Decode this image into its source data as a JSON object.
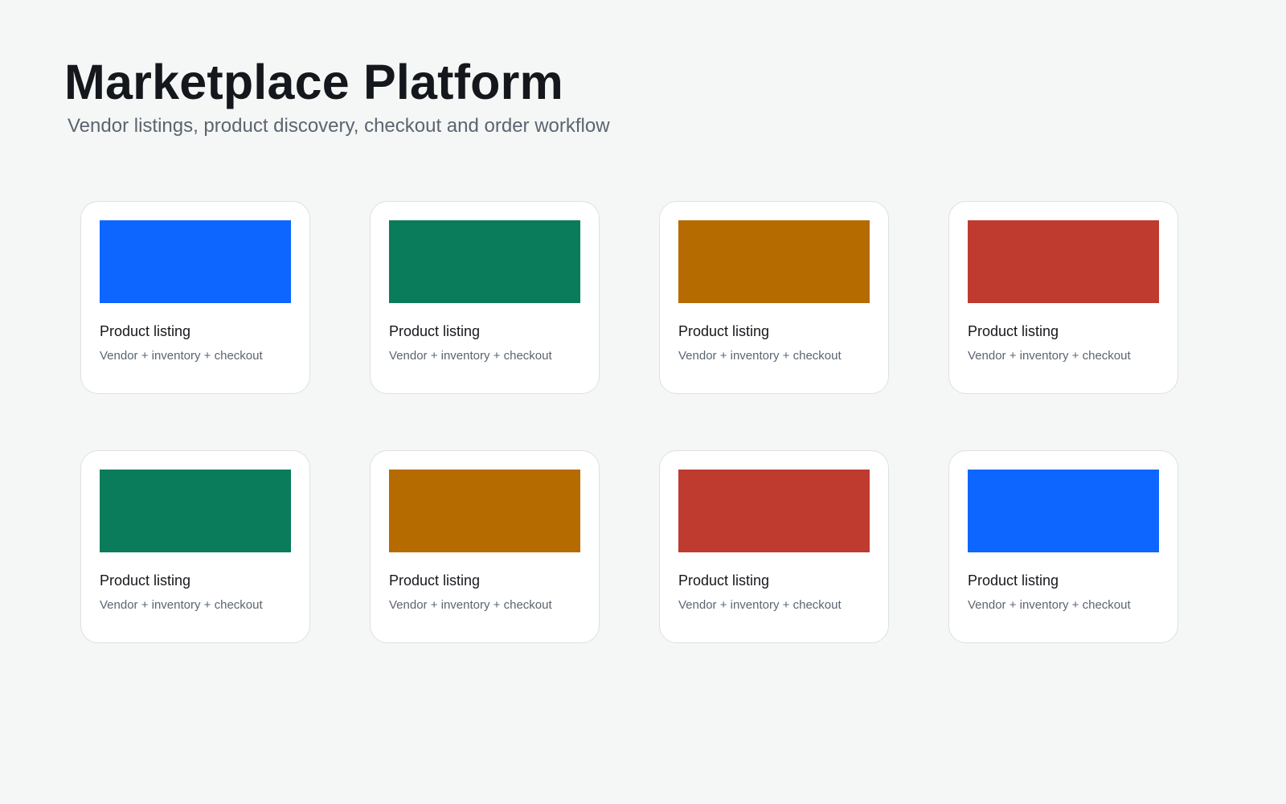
{
  "header": {
    "title": "Marketplace Platform",
    "subtitle": "Vendor listings, product discovery, checkout and order workflow"
  },
  "cards": [
    {
      "title": "Product listing",
      "description": "Vendor + inventory + checkout",
      "color": "#0d66ff"
    },
    {
      "title": "Product listing",
      "description": "Vendor + inventory + checkout",
      "color": "#0b7c5b"
    },
    {
      "title": "Product listing",
      "description": "Vendor + inventory + checkout",
      "color": "#b56b00"
    },
    {
      "title": "Product listing",
      "description": "Vendor + inventory + checkout",
      "color": "#bf3a2f"
    },
    {
      "title": "Product listing",
      "description": "Vendor + inventory + checkout",
      "color": "#0b7c5b"
    },
    {
      "title": "Product listing",
      "description": "Vendor + inventory + checkout",
      "color": "#b56b00"
    },
    {
      "title": "Product listing",
      "description": "Vendor + inventory + checkout",
      "color": "#bf3a2f"
    },
    {
      "title": "Product listing",
      "description": "Vendor + inventory + checkout",
      "color": "#0d66ff"
    }
  ]
}
